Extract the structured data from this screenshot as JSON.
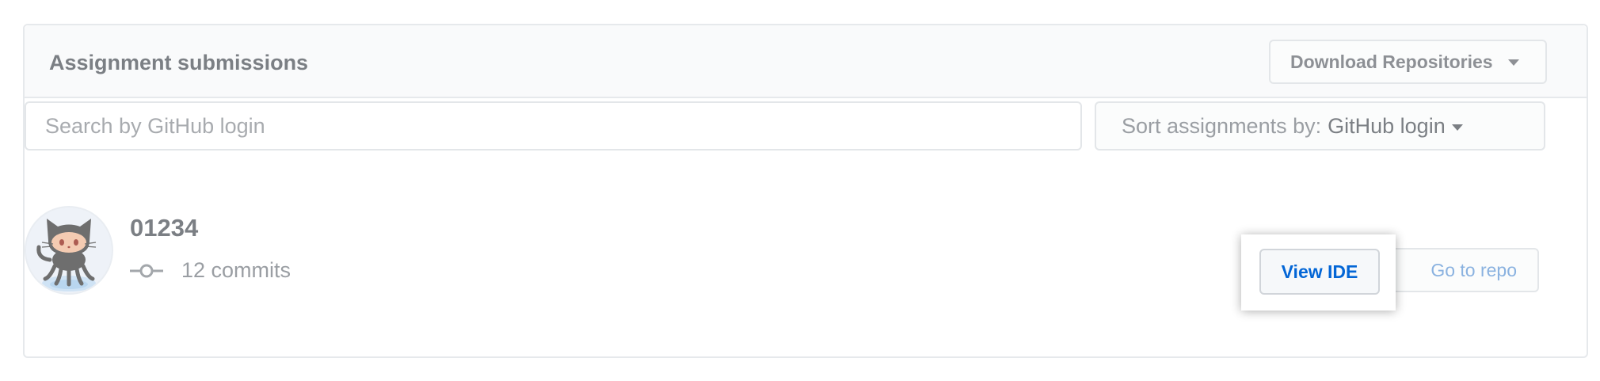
{
  "panel": {
    "title": "Assignment submissions",
    "download_button": {
      "label": "Download Repositories"
    }
  },
  "search": {
    "placeholder": "Search by GitHub login",
    "value": ""
  },
  "sort": {
    "label": "Sort assignments by:",
    "value": "GitHub login"
  },
  "submissions": [
    {
      "login": "01234",
      "avatar_icon": "octocat-icon",
      "commit_icon": "git-commit-icon",
      "commits_label": "12 commits",
      "view_ide_label": "View IDE",
      "go_to_repo_label": "Go to repo"
    }
  ],
  "colors": {
    "link_blue": "#0366d6",
    "link_blue_faded": "#8ab2e0",
    "border": "#e3e6e9",
    "header_bg": "#f9fafb",
    "muted_text": "#7b7f84"
  }
}
